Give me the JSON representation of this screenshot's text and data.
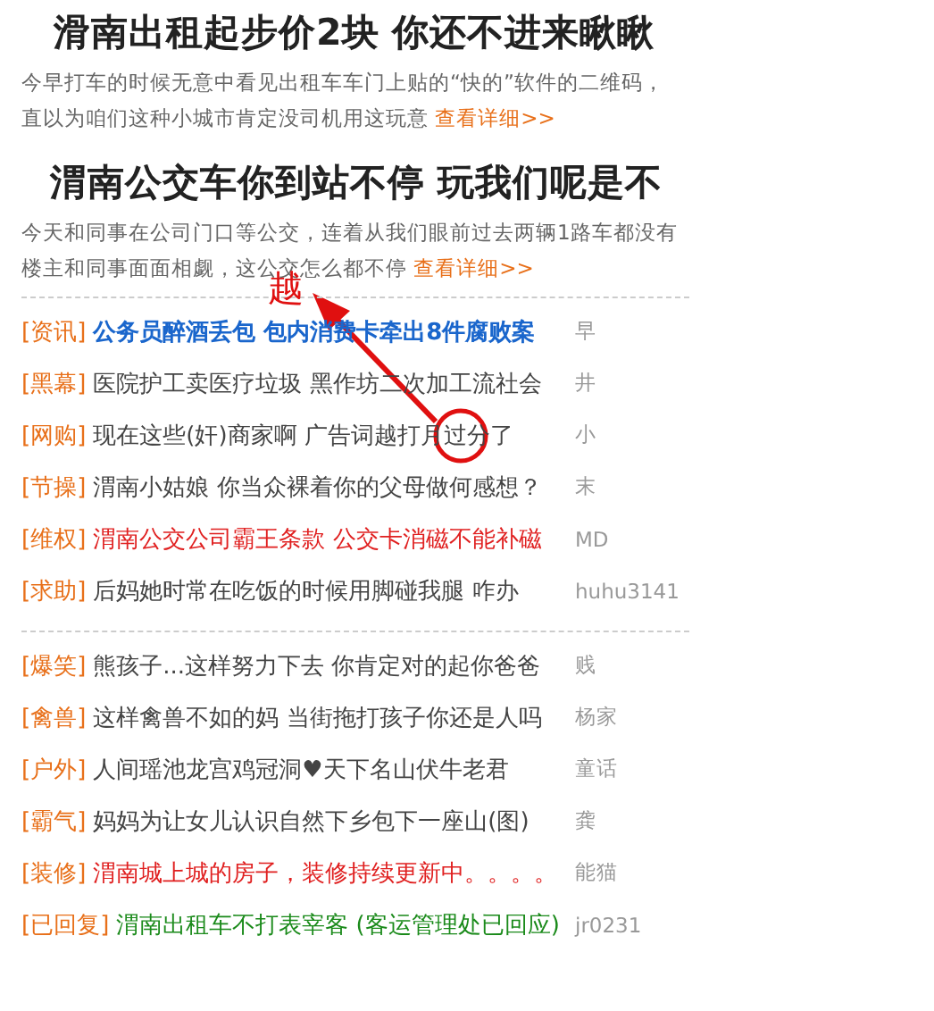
{
  "articles": [
    {
      "headline": "滑南出租起步价2块 你还不进来瞅瞅",
      "summary": [
        "今早打车的时候无意中看见出租车车门上贴的“快的”软件的二维码，",
        "直以为咱们这种小城市肯定没司机用这玩意"
      ],
      "link": "查看详细>>"
    },
    {
      "headline": "渭南公交车你到站不停 玩我们呢是不",
      "summary": [
        "今天和同事在公司门口等公交，连着从我们眼前过去两辆1路车都没有",
        "楼主和同事面面相觑，这公交怎么都不停"
      ],
      "link": "查看详细>>"
    }
  ],
  "annotation": {
    "text": "越"
  },
  "lists": [
    [
      {
        "tag": "[资讯]",
        "title": "公务员醉酒丢包 包内消费卡牵出8件腐败案",
        "color": "#1a66cc",
        "bold": true,
        "author": "早"
      },
      {
        "tag": "[黑幕]",
        "title": "医院护工卖医疗垃圾 黑作坊二次加工流社会",
        "color": "#444444",
        "bold": false,
        "author": "井"
      },
      {
        "tag": "[网购]",
        "title": "现在这些(奸)商家啊 广告词越打月过分了",
        "color": "#444444",
        "bold": false,
        "author": "小"
      },
      {
        "tag": "[节操]",
        "title": "渭南小姑娘 你当众裸着你的父母做何感想？",
        "color": "#444444",
        "bold": false,
        "author": "末"
      },
      {
        "tag": "[维权]",
        "title": "渭南公交公司霸王条款 公交卡消磁不能补磁",
        "color": "#e02020",
        "bold": false,
        "author": "MD"
      },
      {
        "tag": "[求助]",
        "title": "后妈她时常在吃饭的时候用脚碰我腿 咋办",
        "color": "#444444",
        "bold": false,
        "author": "huhu3141"
      }
    ],
    [
      {
        "tag": "[爆笑]",
        "title": "熊孩子...这样努力下去 你肯定对的起你爸爸",
        "color": "#444444",
        "bold": false,
        "author": "贱"
      },
      {
        "tag": "[禽兽]",
        "title": "这样禽兽不如的妈 当街拖打孩子你还是人吗",
        "color": "#444444",
        "bold": false,
        "author": "杨家"
      },
      {
        "tag": "[户外]",
        "title": "人间瑶池龙宫鸡冠洞♥天下名山伏牛老君",
        "color": "#444444",
        "bold": false,
        "author": "童话"
      },
      {
        "tag": "[霸气]",
        "title": "妈妈为让女儿认识自然下乡包下一座山(图)",
        "color": "#444444",
        "bold": false,
        "author": "龚"
      },
      {
        "tag": "[装修]",
        "title": "渭南城上城的房子，装修持续更新中。。。。",
        "color": "#e02020",
        "bold": false,
        "author": "能猫"
      },
      {
        "tag": "[已回复]",
        "title": "渭南出租车不打表宰客 (客运管理处已回应)",
        "color": "#1a8a1a",
        "bold": false,
        "author": "jr0231"
      }
    ]
  ]
}
